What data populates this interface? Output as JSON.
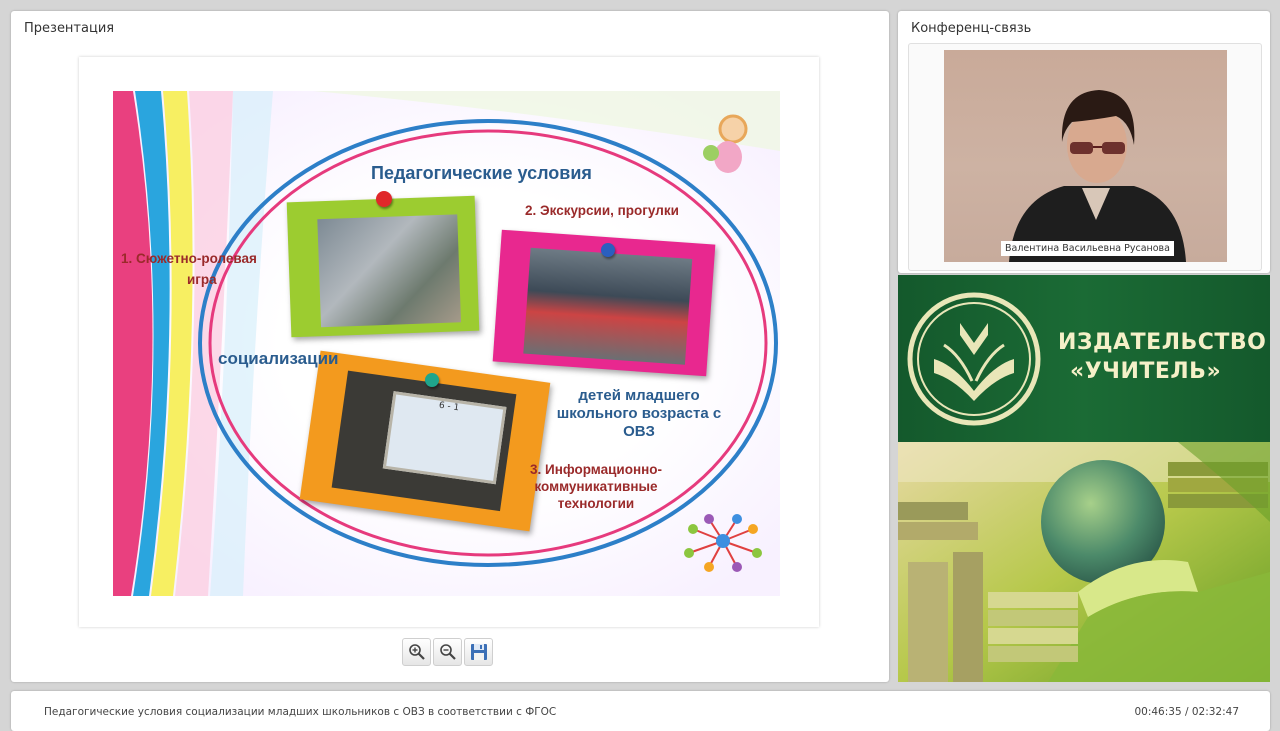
{
  "presentation": {
    "panel_title": "Презентация",
    "slide": {
      "title": "Педагогические условия",
      "item1": "1.   Сюжетно-ролевая",
      "item1_cont": "игра",
      "item2": "2. Экскурсии, прогулки",
      "socialization": "социализации",
      "children_line1": "детей младшего",
      "children_line2": "школьного возраста с",
      "children_line3": "ОВЗ",
      "item3_line1": "3. Информационно-",
      "item3_line2": "коммуникативные",
      "item3_line3": "технологии",
      "photo_board_text": "6 - 1"
    },
    "toolbar": {
      "zoom_in_icon": "zoom-in-icon",
      "zoom_out_icon": "zoom-out-icon",
      "save_icon": "save-icon"
    }
  },
  "conference": {
    "panel_title": "Конференц-связь",
    "speaker_name": "Валентина Васильевна Русанова"
  },
  "ad": {
    "line1": "ИЗДАТЕЛЬСТВО",
    "line2": "«УЧИТЕЛЬ»"
  },
  "footer": {
    "title": "Педагогические условия социализации младших школьников с ОВЗ в соответствии с ФГОС",
    "time": "00:46:35 / 02:32:47"
  },
  "colors": {
    "ad_green": "#1b6b35",
    "slide_blue": "#2a5c8e",
    "slide_red": "#9a2a2a"
  }
}
